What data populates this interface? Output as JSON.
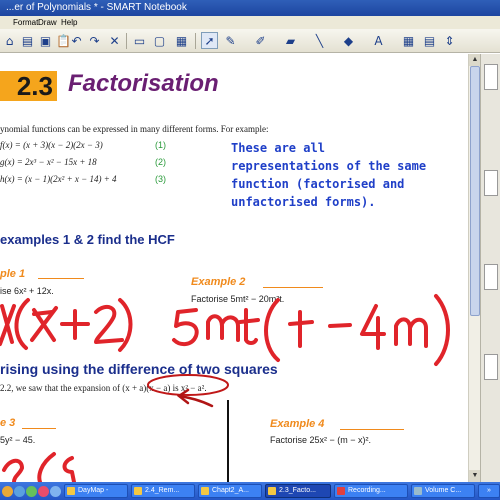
{
  "window": {
    "title": "...er of Polynomials * - SMART Notebook"
  },
  "menu": {
    "items": [
      "Format",
      "Draw",
      "Help"
    ]
  },
  "toolbar": {
    "icons": [
      "home-icon",
      "open-icon",
      "save-icon",
      "paste-icon",
      "undo-icon",
      "redo-icon",
      "delete-icon",
      "screen-shade-icon",
      "fullscreen-icon",
      "table-icon",
      "select-icon",
      "pen-icon",
      "highlighter-icon",
      "eraser-icon",
      "line-icon",
      "fill-icon",
      "text-icon",
      "properties-icon",
      "move-toolbar-icon"
    ]
  },
  "page": {
    "section_number": "2.3",
    "title": "Factorisation",
    "intro": "ynomial functions can be expressed in many different forms. For example:",
    "equations": [
      {
        "text": "f(x) = (x + 3)(x − 2)(2x − 3)",
        "number": "(1)"
      },
      {
        "text": "g(x) = 2x³ − x² − 15x + 18",
        "number": "(2)"
      },
      {
        "text": "h(x) = (x − 1)(2x² + x − 14) + 4",
        "number": "(3)"
      }
    ],
    "note": "These are all representations of the same function (factorised and unfactorised forms).",
    "hcf_heading": "examples 1 & 2 find the HCF",
    "example1": {
      "label": "ple 1",
      "task": "ise 6x² + 12x."
    },
    "example2": {
      "label": "Example 2",
      "task": "Factorise 5mt² − 20m²t."
    },
    "diff_heading": "rising using the difference of two squares",
    "diff_text": "2.2, we saw that the expansion of (x + a)(x − a) is x² − a².",
    "example3": {
      "label": "e 3",
      "task": "5y² − 45."
    },
    "example4": {
      "label": "Example 4",
      "task": "Factorise 25x² − (m − x)²."
    }
  },
  "taskbar": {
    "buttons": [
      {
        "label": "DayMap -",
        "active": false
      },
      {
        "label": "2.4_Rem...",
        "active": false
      },
      {
        "label": "Chapt2_A...",
        "active": false
      },
      {
        "label": "2.3_Facto...",
        "active": true
      },
      {
        "label": "Recording...",
        "active": false
      },
      {
        "label": "Volume C...",
        "active": false
      }
    ]
  },
  "colors": {
    "title_purple": "#6a1f72",
    "badge_orange": "#f5a51c",
    "heading_navy": "#1a2e8c",
    "note_blue": "#1f3fc8",
    "ink_red": "#e0242a",
    "example_orange": "#f08a1c"
  }
}
